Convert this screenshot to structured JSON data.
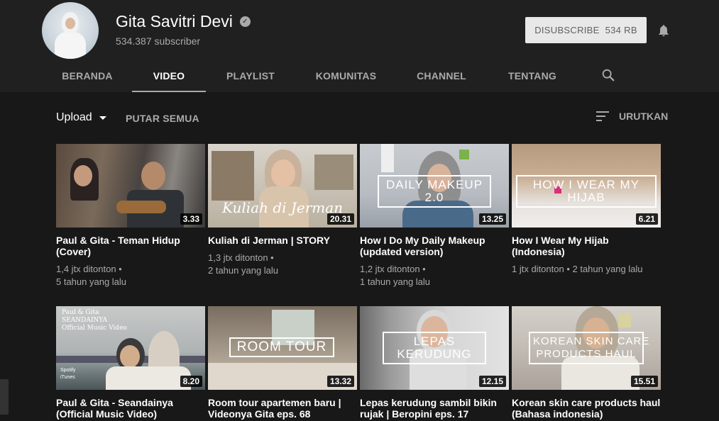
{
  "channel": {
    "name": "Gita Savitri Devi",
    "subscribers": "534.387 subscriber",
    "unsubscribe_label": "DISUBSCRIBE",
    "unsubscribe_count": "534 RB"
  },
  "tabs": [
    "BERANDA",
    "VIDEO",
    "PLAYLIST",
    "KOMUNITAS",
    "CHANNEL",
    "TENTANG"
  ],
  "active_tab": "VIDEO",
  "toolbar": {
    "upload_label": "Upload",
    "play_all_label": "PUTAR SEMUA",
    "sort_label": "URUTKAN"
  },
  "videos": [
    {
      "title": "Paul & Gita - Teman Hidup (Cover)",
      "views": "1,4 jtx ditonton",
      "age": "5 tahun yang lalu",
      "duration": "3.33",
      "overlay": ""
    },
    {
      "title": "Kuliah di Jerman | STORY",
      "views": "1,3 jtx ditonton",
      "age": "2 tahun yang lalu",
      "duration": "20.31",
      "overlay": "Kuliah di Jerman"
    },
    {
      "title": "How I Do My Daily Makeup (updated version)",
      "views": "1,2 jtx ditonton",
      "age": "1 tahun yang lalu",
      "duration": "13.25",
      "overlay": "DAILY MAKEUP 2.0"
    },
    {
      "title": "How I Wear My Hijab (Indonesia)",
      "views": "1 jtx ditonton",
      "age": "2 tahun yang lalu",
      "duration": "6.21",
      "overlay": "HOW I WEAR MY HIJAB"
    },
    {
      "title": "Paul & Gita - Seandainya (Official Music Video)",
      "views": "",
      "age": "",
      "duration": "8.20",
      "overlay": "Paul & Gita\nSEANDAINYA\nOfficial Music Video"
    },
    {
      "title": "Room tour apartemen baru | Videonya Gita eps. 68",
      "views": "",
      "age": "",
      "duration": "13.32",
      "overlay": "ROOM TOUR"
    },
    {
      "title": "Lepas kerudung sambil bikin rujak | Beropini eps. 17",
      "views": "",
      "age": "",
      "duration": "12.15",
      "overlay": "LEPAS\nKERUDUNG"
    },
    {
      "title": "Korean skin care products haul (Bahasa indonesia)",
      "views": "",
      "age": "",
      "duration": "15.51",
      "overlay": "KOREAN SKIN CARE\nPRODUCTS HAUL"
    }
  ],
  "thumb4_badges": [
    "Spotify",
    "iTunes"
  ]
}
